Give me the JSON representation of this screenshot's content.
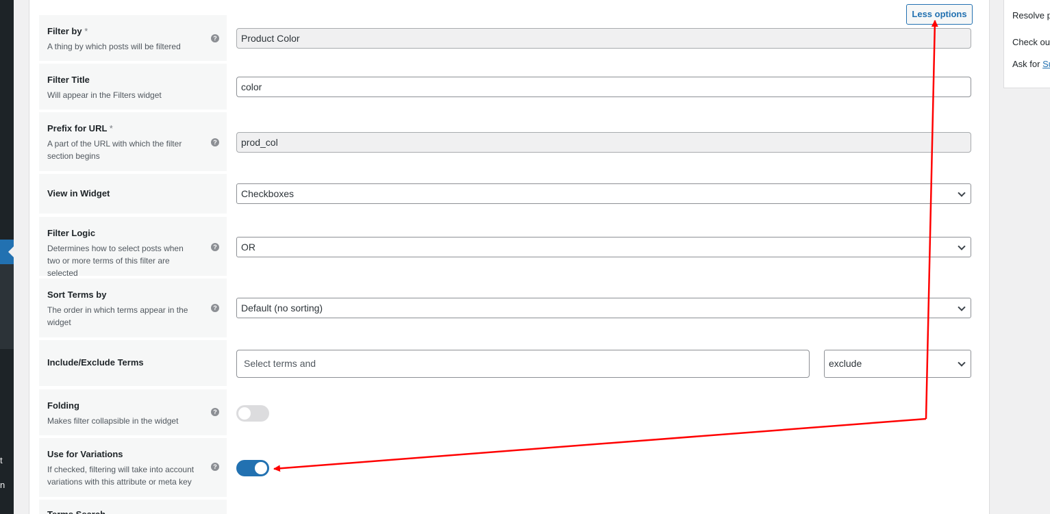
{
  "toolbar": {
    "less_options_label": "Less options"
  },
  "rows": {
    "filter_by": {
      "title": "Filter by",
      "required": "*",
      "desc": "A thing by which posts will be filtered",
      "value": "Product Color"
    },
    "filter_title": {
      "title": "Filter Title",
      "desc": "Will appear in the Filters widget",
      "value": "color"
    },
    "prefix_url": {
      "title": "Prefix for URL",
      "required": "*",
      "desc": "A part of the URL with which the filter section begins",
      "value": "prod_col"
    },
    "view_widget": {
      "title": "View in Widget",
      "value": "Checkboxes"
    },
    "filter_logic": {
      "title": "Filter Logic",
      "desc": "Determines how to select posts when two or more terms of this filter are selected",
      "value": "OR"
    },
    "sort_terms": {
      "title": "Sort Terms by",
      "desc": "The order in which terms appear in the widget",
      "value": "Default (no sorting)"
    },
    "include_exclude": {
      "title": "Include/Exclude Terms",
      "placeholder": "Select terms and",
      "mode": "exclude"
    },
    "folding": {
      "title": "Folding",
      "desc": "Makes filter collapsible in the widget",
      "enabled": false
    },
    "use_variations": {
      "title": "Use for Variations",
      "desc": "If checked, filtering will take into account variations with this attribute or meta key",
      "enabled": true
    },
    "next_row": {
      "title": "Terms Search"
    }
  },
  "help_glyph": "?",
  "side_box": {
    "line1": "Resolve p",
    "line2": "Check out",
    "line3_prefix": "Ask for ",
    "line3_link": "Su"
  },
  "admin_sidebar": {
    "fragment1": "t",
    "fragment2": "n"
  },
  "colors": {
    "accent": "#2271b1",
    "annotation": "#ff0000",
    "admin_dark": "#1d2327"
  }
}
